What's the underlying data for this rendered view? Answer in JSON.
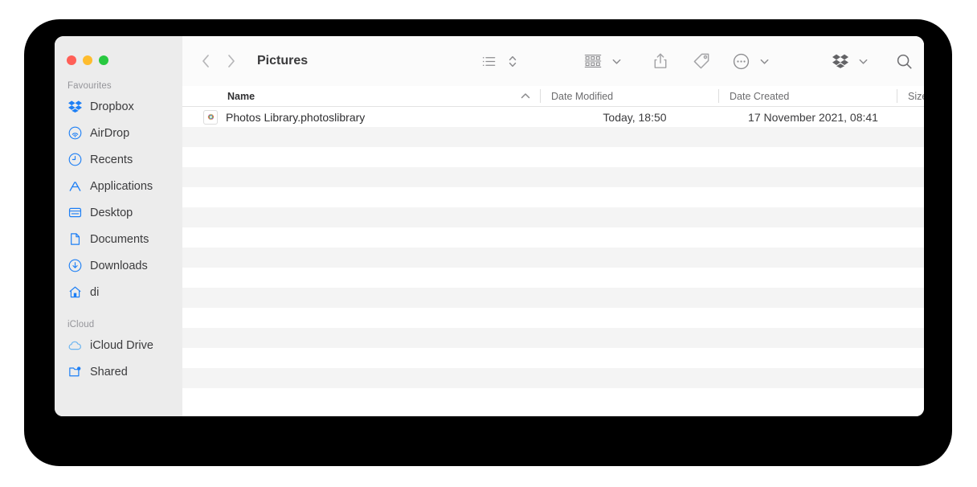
{
  "window": {
    "title": "Pictures",
    "traffic_lights": [
      {
        "name": "close",
        "color": "#ff5f57"
      },
      {
        "name": "minimize",
        "color": "#febc2e"
      },
      {
        "name": "maximize",
        "color": "#28c840"
      }
    ]
  },
  "sidebar": {
    "sections": [
      {
        "label": "Favourites",
        "items": [
          {
            "label": "Dropbox",
            "icon": "dropbox-icon"
          },
          {
            "label": "AirDrop",
            "icon": "airdrop-icon"
          },
          {
            "label": "Recents",
            "icon": "clock-icon"
          },
          {
            "label": "Applications",
            "icon": "applications-icon"
          },
          {
            "label": "Desktop",
            "icon": "desktop-icon"
          },
          {
            "label": "Documents",
            "icon": "document-icon"
          },
          {
            "label": "Downloads",
            "icon": "download-icon"
          },
          {
            "label": "di",
            "icon": "home-icon"
          }
        ]
      },
      {
        "label": "iCloud",
        "items": [
          {
            "label": "iCloud Drive",
            "icon": "cloud-icon"
          },
          {
            "label": "Shared",
            "icon": "shared-folder-icon"
          }
        ]
      }
    ]
  },
  "toolbar": {
    "back": "back-icon",
    "forward": "forward-icon",
    "view_list": "list-view-icon",
    "sort": "sort-chevrons-icon",
    "group": "group-by-icon",
    "group_chevron": "chevron-down-icon",
    "share": "share-icon",
    "tag": "tag-icon",
    "more": "more-options-icon",
    "more_chevron": "chevron-down-icon",
    "dropbox": "dropbox-icon",
    "dropbox_chevron": "chevron-down-icon",
    "search": "search-icon"
  },
  "columns": {
    "name": "Name",
    "date_modified": "Date Modified",
    "date_created": "Date Created",
    "size": "Size",
    "sort_column": "Name",
    "sort_direction": "ascending"
  },
  "files": [
    {
      "name": "Photos Library.photoslibrary",
      "icon": "photos-library-icon",
      "date_modified": "Today, 18:50",
      "date_created": "17 November 2021, 08:41",
      "size": ""
    }
  ],
  "colors": {
    "sidebar_bg": "#ececec",
    "toolbar_bg": "#fbfbfb",
    "accent_blue": "#1d7ff5",
    "row_stripe": "#f4f4f4",
    "bezel": "#000000"
  }
}
